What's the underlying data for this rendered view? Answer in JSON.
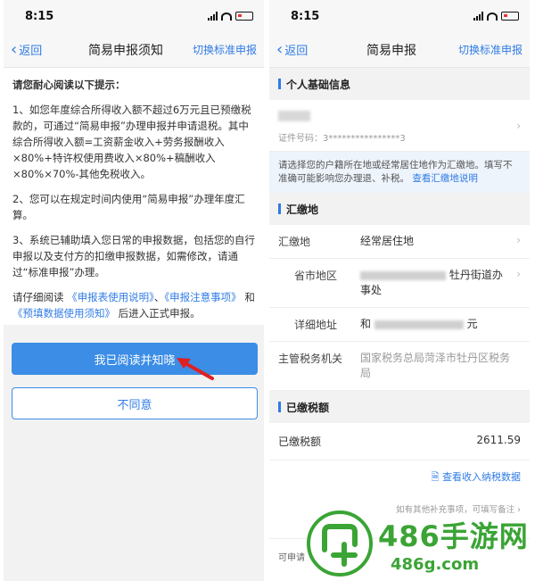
{
  "left": {
    "status_time": "8:15",
    "back_label": "返回",
    "title": "简易申报须知",
    "right_action": "切换标准申报",
    "notice_heading": "请您耐心阅读以下提示：",
    "para1": "1、如您年度综合所得收入额不超过6万元且已预缴税款的，可通过“简易申报”办理申报并申请退税。其中综合所得收入额=工资薪金收入+劳务报酬收入×80%+特许权使用费收入×80%+稿酬收入×80%×70%-其他免税收入。",
    "para2": "2、您可以在规定时间内使用“简易申报”办理年度汇算。",
    "para3": "3、系统已辅助填入您日常的申报数据，包括您的自行申报以及支付方的扣缴申报数据，如需修改，请通过“标准申报”办理。",
    "para4_prefix": "请仔细阅读",
    "para4_link1": "《申报表使用说明》",
    "para4_sep1": "、",
    "para4_link2": "《申报注意事项》",
    "para4_sep2": "和",
    "para4_link3": "《预填数据使用须知》",
    "para4_suffix": "后进入正式申报。",
    "agree_button": "我已阅读并知晓",
    "disagree_button": "不同意"
  },
  "right": {
    "status_time": "8:15",
    "back_label": "返回",
    "title": "简易申报",
    "right_action": "切换标准申报",
    "section_basic": "个人基础信息",
    "id_label": "证件号码：",
    "id_value": "3****************3",
    "tip_text": "请选择您的户籍所在地或经常居住地作为汇缴地。填写不准确可能影响您办理退、补税。",
    "tip_link": "查看汇缴地说明",
    "section_remit": "汇缴地",
    "remit_label": "汇缴地",
    "remit_value": "经常居住地",
    "province_label": "省市地区",
    "province_value_end": "牡丹街道办事处",
    "address_label": "详细地址",
    "address_value_start": "和",
    "address_value_end": "元",
    "tax_office_label": "主管税务机关",
    "tax_office_value": "国家税务总局菏泽市牡丹区税务局",
    "section_paid": "已缴税额",
    "paid_label": "已缴税额",
    "paid_value": "2611.59",
    "view_income_link": "查看收入纳税数据",
    "hint_text": "如有其他补充事项，可填写备注",
    "bottom_text": "可申请"
  },
  "watermark": {
    "main": "486手游网",
    "sub": "486g.com"
  },
  "colors": {
    "accent": "#2f7be5",
    "button": "#3b8de6",
    "watermark": "#3aa435",
    "arrow": "#e02020"
  }
}
